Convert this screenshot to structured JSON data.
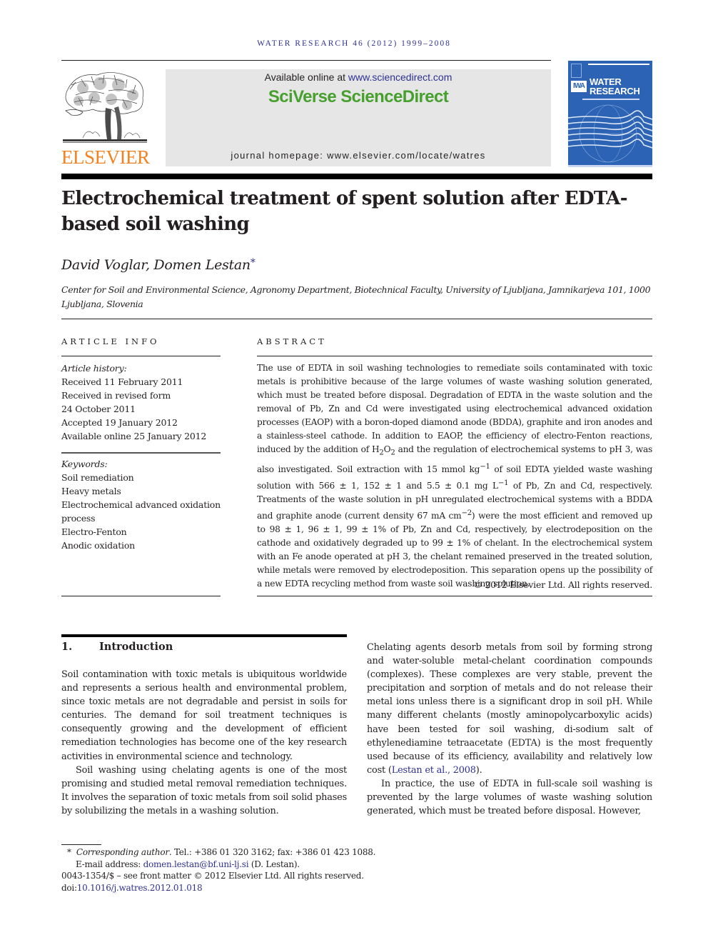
{
  "header": {
    "running_head": "WATER RESEARCH 46 (2012) 1999–2008",
    "publisher_logo_text": "ELSEVIER",
    "available_online_prefix": "Available online at ",
    "available_online_link": "www.sciencedirect.com",
    "platform_brand": "SciVerse ScienceDirect",
    "journal_homepage": "journal homepage: www.elsevier.com/locate/watres",
    "cover": {
      "publisher_badge": "IWA",
      "title_line1": "WATER",
      "title_line2": "RESEARCH"
    }
  },
  "article": {
    "title": "Electrochemical treatment of spent solution after EDTA-based soil washing",
    "authors": "David Voglar, Domen Lestan",
    "corresponding_marker": "*",
    "affiliation": "Center for Soil and Environmental Science, Agronomy Department, Biotechnical Faculty, University of Ljubljana, Jamnikarjeva 101, 1000 Ljubljana, Slovenia"
  },
  "article_info": {
    "label": "ARTICLE INFO",
    "history_label": "Article history:",
    "history": [
      "Received 11 February 2011",
      "Received in revised form",
      "24 October 2011",
      "Accepted 19 January 2012",
      "Available online 25 January 2012"
    ],
    "keywords_label": "Keywords:",
    "keywords": [
      "Soil remediation",
      "Heavy metals",
      "Electrochemical advanced oxidation process",
      "Electro-Fenton",
      "Anodic oxidation"
    ]
  },
  "abstract": {
    "label": "ABSTRACT",
    "text_1": "The use of EDTA in soil washing technologies to remediate soils contaminated with toxic metals is prohibitive because of the large volumes of waste washing solution generated, which must be treated before disposal. Degradation of EDTA in the waste solution and the removal of Pb, Zn and Cd were investigated using electrochemical advanced oxidation processes (EAOP) with a boron-doped diamond anode (BDDA), graphite and iron anodes and a stainless-steel cathode. In addition to EAOP, the efficiency of electro-Fenton reactions, induced by the addition of H",
    "sub_2a": "2",
    "text_2": "O",
    "sub_2b": "2",
    "text_3": " and the regulation of electrochemical systems to pH 3, was also investigated. Soil extraction with 15 mmol kg",
    "sup_1": "−1",
    "text_4": " of soil EDTA yielded waste washing solution with 566 ± 1, 152 ± 1 and 5.5 ± 0.1 mg L",
    "sup_2": "−1",
    "text_5": " of Pb, Zn and Cd, respectively. Treatments of the waste solution in pH unregulated electrochemical systems with a BDDA and graphite anode (current density 67 mA cm",
    "sup_3": "−2",
    "text_6": ") were the most efficient and removed up to 98 ± 1, 96 ± 1, 99 ± 1% of Pb, Zn and Cd, respectively, by electrodeposition on the cathode and oxidatively degraded up to 99 ± 1% of chelant. In the electrochemical system with an Fe anode operated at pH 3, the chelant remained preserved in the treated solution, while metals were removed by electrodeposition. This separation opens up the possibility of a new EDTA recycling method from waste soil washing solution.",
    "copyright": "© 2012 Elsevier Ltd. All rights reserved."
  },
  "introduction": {
    "number": "1.",
    "heading": "Introduction",
    "left_p1": "Soil contamination with toxic metals is ubiquitous worldwide and represents a serious health and environmental problem, since toxic metals are not degradable and persist in soils for centuries. The demand for soil treatment techniques is consequently growing and the development of efficient remediation technologies has become one of the key research activities in environmental science and technology.",
    "left_p2": "Soil washing using chelating agents is one of the most promising and studied metal removal remediation techniques. It involves the separation of toxic metals from soil solid phases by solubilizing the metals in a washing solution.",
    "right_p1_a": "Chelating agents desorb metals from soil by forming strong and water-soluble metal-chelant coordination compounds (complexes). These complexes are very stable, prevent the precipitation and sorption of metals and do not release their metal ions unless there is a significant drop in soil pH. While many different chelants (mostly aminopolycarboxylic acids) have been tested for soil washing, di-sodium salt of ethylenediamine tetraacetate (EDTA) is the most frequently used because of its efficiency, availability and relatively low cost (",
    "right_p1_cite": "Lestan et al., 2008",
    "right_p1_b": ").",
    "right_p2": "In practice, the use of EDTA in full-scale soil washing is prevented by the large volumes of waste washing solution generated, which must be treated before disposal. However,"
  },
  "footnotes": {
    "marker": "*",
    "corresponding_label": "Corresponding author",
    "contact": ". Tel.: +386 01 320 3162; fax: +386 01 423 1088.",
    "email_label": "E-mail address: ",
    "email": "domen.lestan@bf.uni-lj.si",
    "email_suffix": " (D. Lestan).",
    "issn_line": "0043-1354/$ – see front matter © 2012 Elsevier Ltd. All rights reserved.",
    "doi_prefix": "doi:",
    "doi": "10.1016/j.watres.2012.01.018"
  },
  "colors": {
    "link_blue": "#2e3192",
    "elsevier_orange": "#f58220",
    "sciverse_green": "#47a02d",
    "cover_blue": "#2c63b4"
  }
}
